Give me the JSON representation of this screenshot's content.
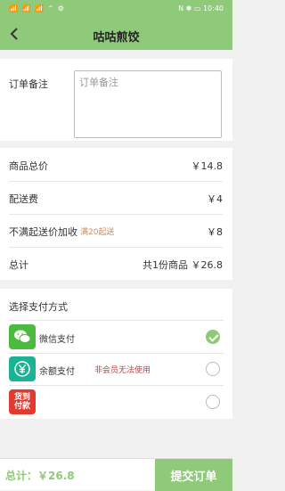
{
  "status_bar": {
    "left": "📶 📶 📶 ⌃ ⚙",
    "right": "N ✱ ▭ 10:40"
  },
  "header": {
    "title": "咕咕煎饺"
  },
  "remark": {
    "label": "订单备注",
    "placeholder": "订单备注",
    "value": ""
  },
  "summary": {
    "goods_total_label": "商品总价",
    "goods_total_value": "￥14.8",
    "delivery_fee_label": "配送费",
    "delivery_fee_value": "￥4",
    "min_surcharge_label": "不满起送价加收",
    "min_surcharge_hint": "满20起送",
    "min_surcharge_value": "￥8",
    "total_label": "总计",
    "total_value": "共1份商品 ￥26.8"
  },
  "payment": {
    "heading": "选择支付方式",
    "options": [
      {
        "name": "微信支付",
        "icon": "wechat-pay-icon",
        "note": "",
        "selected": true
      },
      {
        "name": "余额支付",
        "icon": "yen-balance-icon",
        "note": "非会员无法使用",
        "selected": false
      },
      {
        "name": "",
        "icon": "cash-on-delivery-icon",
        "icon_text": "货到付款",
        "note": "",
        "selected": false
      }
    ]
  },
  "bottom_bar": {
    "total": "总计：￥26.8",
    "submit_label": "提交订单"
  },
  "colors": {
    "accent": "#8fc97a",
    "wechat": "#4cba3f",
    "balance": "#1ab394",
    "cod": "#e23a2e"
  }
}
